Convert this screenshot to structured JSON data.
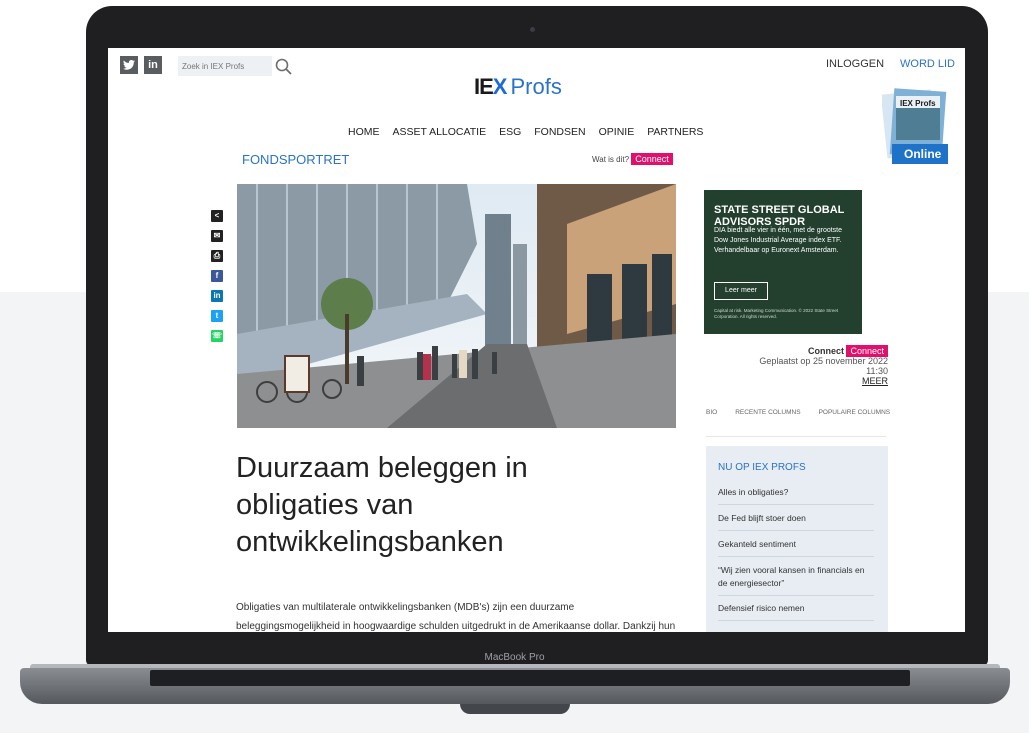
{
  "device": {
    "bezel_label": "MacBook Pro"
  },
  "header": {
    "social": [
      "twitter-icon",
      "linkedin-icon"
    ],
    "search_placeholder": "Zoek in IEX Profs",
    "logo_mark": "IE",
    "logo_x": "X",
    "logo_word": "Profs",
    "login": "INLOGGEN",
    "signup": "WORD LID",
    "magazine_label": "Online"
  },
  "nav": [
    "HOME",
    "ASSET ALLOCATIE",
    "ESG",
    "FONDSEN",
    "OPINIE",
    "PARTNERS"
  ],
  "section": {
    "title": "FONDSPORTRET",
    "what_is": "Wat is dit?",
    "connect_badge": "Connect"
  },
  "article": {
    "headline": "Duurzaam beleggen in obligaties van ontwikkelingsbanken",
    "body": "Obligaties van multilaterale ontwikkelingsbanken (MDB's) zijn een duurzame beleggingsmogelijkheid in hoogwaardige schulden uitgedrukt in de Amerikaanse dollar. Dankzij hun hoge kredietwaardigheid"
  },
  "share_icons": [
    "share-icon",
    "email-icon",
    "print-icon",
    "facebook-icon",
    "linkedin-icon",
    "twitter-icon",
    "whatsapp-icon"
  ],
  "colors": {
    "accent": "#2a73c9",
    "connect_pink": "#e0106c",
    "ad_green": "#23402e",
    "sidebar_bg": "#e7edf3"
  },
  "ad": {
    "brand": "STATE STREET GLOBAL ADVISORS SPDR",
    "copy": "DIA biedt alle vier in één, met de grootste Dow Jones Industrial Average index ETF. Verhandelbaar op Euronext Amsterdam.",
    "button": "Leer meer",
    "fine_print": "Capital at risk. Marketing Communication. © 2022 State Street Corporation. All rights reserved."
  },
  "sidebar": {
    "connect_label": "Connect",
    "connect_badge": "Connect",
    "posted": "Geplaatst op 25 november 2022",
    "time": "11:30",
    "more": "MEER",
    "tabs": [
      "BIO",
      "RECENTE COLUMNS",
      "POPULAIRE COLUMNS"
    ],
    "nu_title": "NU OP IEX PROFS",
    "nu_items": [
      "Alles in obligaties?",
      "De Fed blijft stoer doen",
      "Gekanteld sentiment",
      "“Wij zien vooral kansen in financials en de energiesector”",
      "Defensief risico nemen"
    ]
  }
}
